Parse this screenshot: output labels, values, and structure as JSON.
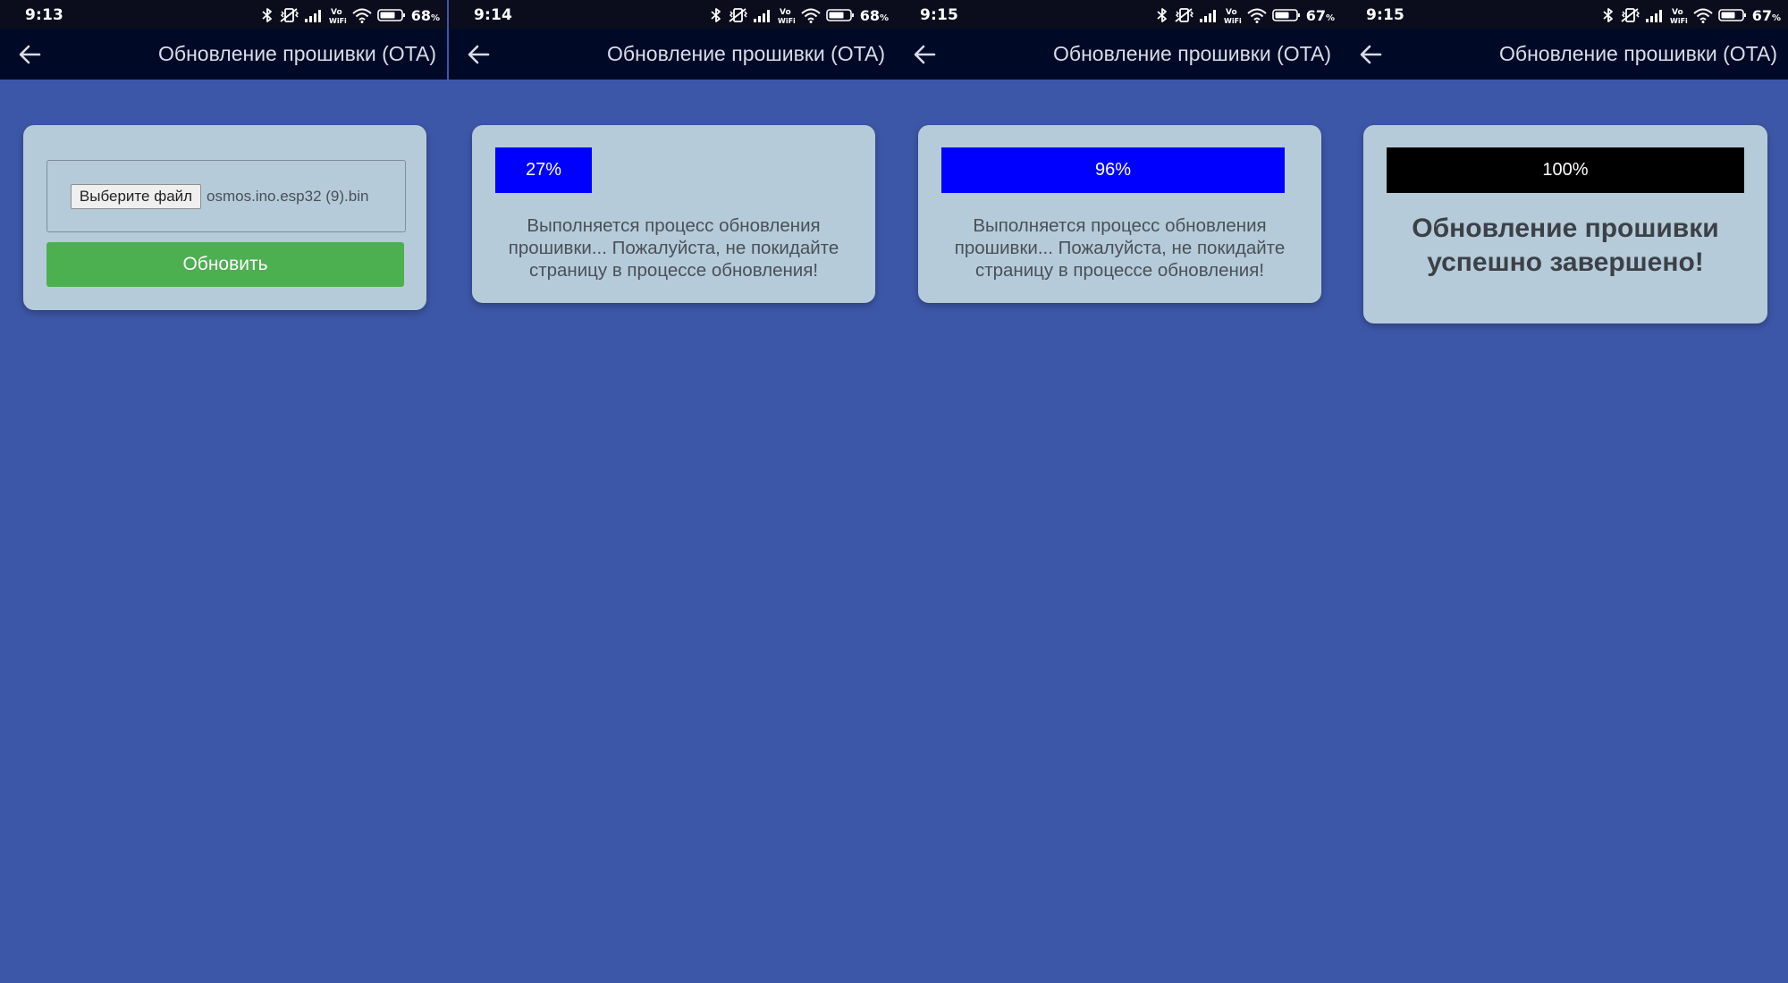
{
  "app_title": "Обновление прошивки (OTA)",
  "colors": {
    "background": "#3d57a8",
    "card": "#b5cbda",
    "update_button": "#4caf50",
    "progress_active": "#0000ff",
    "progress_done": "#000000"
  },
  "screens": [
    {
      "status": {
        "time": "9:13",
        "battery": "68",
        "battery_unit": "%"
      },
      "title": "Обновление прошивки (OTA)",
      "file_button_label": "Выберите файл",
      "file_name": "osmos.ino.esp32 (9).bin",
      "update_button_label": "Обновить"
    },
    {
      "status": {
        "time": "9:14",
        "battery": "68",
        "battery_unit": "%"
      },
      "title": "Обновление прошивки (OTA)",
      "progress": 0.27,
      "progress_label": "27%",
      "message": "Выполняется процесс обновления прошивки... Пожалуйста, не покидайте страницу в процессе обновления!"
    },
    {
      "status": {
        "time": "9:15",
        "battery": "67",
        "battery_unit": "%"
      },
      "title": "Обновление прошивки (OTA)",
      "progress": 0.96,
      "progress_label": "96%",
      "message": "Выполняется процесс обновления прошивки... Пожалуйста, не покидайте страницу в процессе обновления!"
    },
    {
      "status": {
        "time": "9:15",
        "battery": "67",
        "battery_unit": "%"
      },
      "title": "Обновление прошивки (OTA)",
      "progress": 1.0,
      "progress_label": "100%",
      "message": "Обновление прошивки успешно завершено!"
    }
  ],
  "icons": {
    "back": "arrow-left-icon",
    "status": [
      "bluetooth-icon",
      "vibrate-icon",
      "signal-icon",
      "vowifi-icon",
      "wifi-icon",
      "battery-icon"
    ]
  }
}
